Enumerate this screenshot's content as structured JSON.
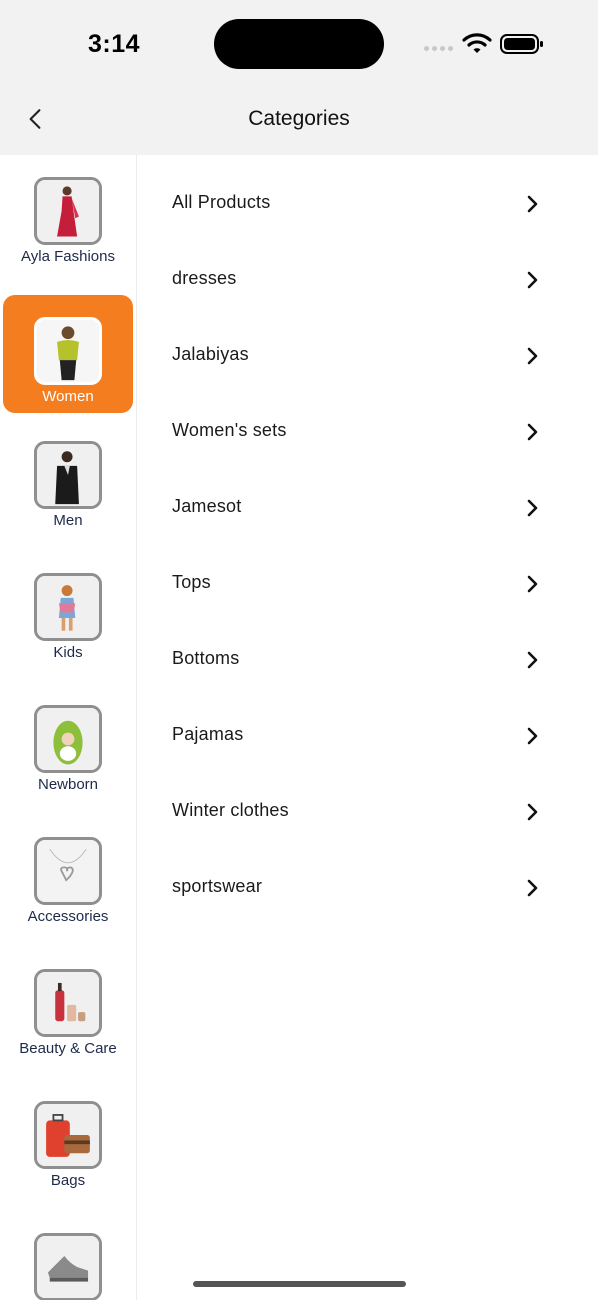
{
  "status_bar": {
    "time": "3:14"
  },
  "header": {
    "title": "Categories"
  },
  "sidebar": {
    "items": [
      {
        "label": "Ayla Fashions",
        "active": false
      },
      {
        "label": "Women",
        "active": true
      },
      {
        "label": "Men",
        "active": false
      },
      {
        "label": "Kids",
        "active": false
      },
      {
        "label": "Newborn",
        "active": false
      },
      {
        "label": "Accessories",
        "active": false
      },
      {
        "label": "Beauty & Care",
        "active": false
      },
      {
        "label": "Bags",
        "active": false
      },
      {
        "label": "",
        "active": false
      }
    ]
  },
  "subcategories": [
    {
      "label": "All Products"
    },
    {
      "label": "dresses"
    },
    {
      "label": "Jalabiyas"
    },
    {
      "label": "Women's sets"
    },
    {
      "label": "Jamesot"
    },
    {
      "label": "Tops"
    },
    {
      "label": "Bottoms"
    },
    {
      "label": "Pajamas"
    },
    {
      "label": "Winter clothes"
    },
    {
      "label": "sportswear"
    }
  ],
  "colors": {
    "accent": "#f47d20",
    "header_bg": "#f2f2f2"
  }
}
